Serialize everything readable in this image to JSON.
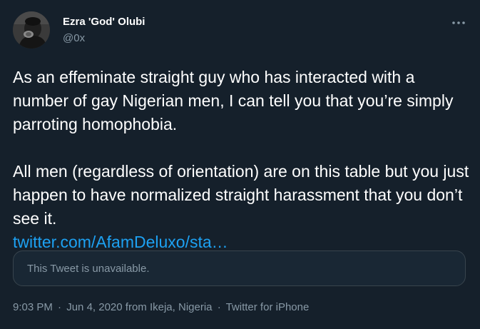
{
  "author": {
    "name": "Ezra 'God' Olubi",
    "handle": "@0x"
  },
  "tweet": {
    "paragraph_1": "As an effeminate straight guy who has interacted with a number of gay Nigerian men, I can tell you that you’re simply parroting homophobia.",
    "paragraph_2": "All men (regardless of orientation) are on this table but you just happen to have normalized straight harassment that you don’t see it.",
    "link_text": "twitter.com/AfamDeluxo/sta…"
  },
  "quoted_tweet": {
    "unavailable_text": "This Tweet is unavailable."
  },
  "meta": {
    "time": "9:03 PM",
    "separator": "·",
    "date": "Jun 4, 2020",
    "location": "from Ikeja, Nigeria",
    "source": "Twitter for iPhone"
  },
  "icons": {
    "more": "more-horizontal-icon",
    "avatar": "user-avatar"
  },
  "colors": {
    "background": "#15202b",
    "text_primary": "#ffffff",
    "text_secondary": "#8899a6",
    "link": "#1da1f2",
    "border": "#38444d"
  }
}
